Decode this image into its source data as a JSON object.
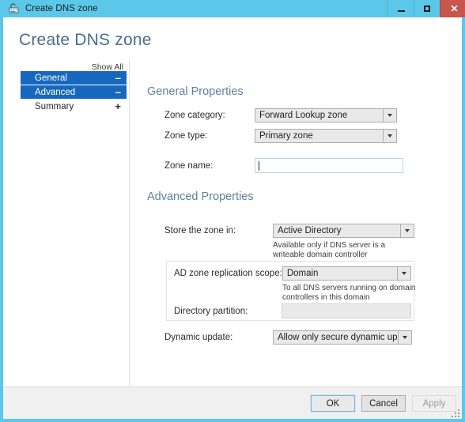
{
  "window": {
    "title": "Create DNS zone",
    "icon": "dns-zone-icon",
    "controls": {
      "minimize": "minimize-icon",
      "maximize": "maximize-icon",
      "close": "✕"
    }
  },
  "page": {
    "heading": "Create DNS zone"
  },
  "nav": {
    "show_all": "Show All",
    "items": [
      {
        "label": "General",
        "sign": "–",
        "selected": true
      },
      {
        "label": "Advanced",
        "sign": "–",
        "selected": true
      },
      {
        "label": "Summary",
        "sign": "+",
        "selected": false
      }
    ]
  },
  "general": {
    "title": "General Properties",
    "zone_category": {
      "label": "Zone category:",
      "value": "Forward Lookup zone"
    },
    "zone_type": {
      "label": "Zone type:",
      "value": "Primary zone"
    },
    "zone_name": {
      "label": "Zone name:",
      "value": "",
      "placeholder": ""
    }
  },
  "advanced": {
    "title": "Advanced Properties",
    "store_zone": {
      "label": "Store the zone in:",
      "value": "Active Directory",
      "helper": "Available only if DNS server is a writeable domain controller"
    },
    "replication_scope": {
      "label": "AD zone replication scope:",
      "value": "Domain",
      "helper": "To all DNS servers running on domain controllers in this domain"
    },
    "directory_partition": {
      "label": "Directory partition:",
      "value": ""
    },
    "dynamic_update": {
      "label": "Dynamic update:",
      "value": "Allow only secure dynamic updates (rec"
    }
  },
  "footer": {
    "ok": "OK",
    "cancel": "Cancel",
    "apply": "Apply"
  },
  "colors": {
    "titlebar": "#5bc8ea",
    "close_button": "#c7564e",
    "nav_selected": "#1568bd",
    "heading": "#4a6d8c",
    "section_heading": "#5f7f9c"
  }
}
